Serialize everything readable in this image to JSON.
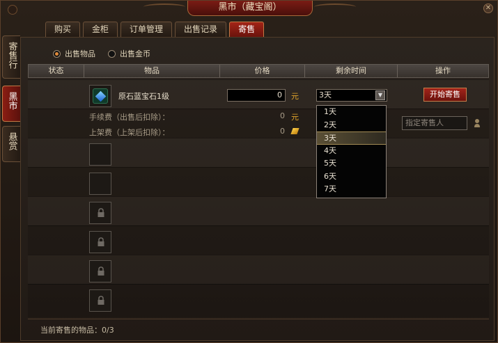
{
  "window": {
    "title": "黑市（藏宝阁）",
    "close_icon": "close-icon"
  },
  "tabs": [
    {
      "label": "购买",
      "active": false
    },
    {
      "label": "金柜",
      "active": false
    },
    {
      "label": "订单管理",
      "active": false
    },
    {
      "label": "出售记录",
      "active": false
    },
    {
      "label": "寄售",
      "active": true
    }
  ],
  "side_tabs": [
    {
      "label": "寄售行",
      "active": false
    },
    {
      "label": "黑市",
      "active": true
    },
    {
      "label": "悬赏",
      "active": false
    }
  ],
  "radios": [
    {
      "label": "出售物品",
      "checked": true
    },
    {
      "label": "出售金币",
      "checked": false
    }
  ],
  "table_headers": [
    "状态",
    "物品",
    "价格",
    "剩余时间",
    "操作"
  ],
  "item": {
    "name": "原石蓝宝石1级",
    "price_value": "0",
    "currency": "元"
  },
  "fee_rows": [
    {
      "label": "手续费（出售后扣除）：",
      "value": "0",
      "unit": "元"
    },
    {
      "label": "上架费（上架后扣除）：",
      "value": "0",
      "unit": "gold-ingot-icon"
    }
  ],
  "duration_select": {
    "selected": "3天",
    "options": [
      "1天",
      "2天",
      "3天",
      "4天",
      "5天",
      "6天",
      "7天"
    ]
  },
  "start_button": "开始寄售",
  "seller_input": {
    "placeholder": "指定寄售人"
  },
  "footer": {
    "text": "当前寄售的物品：0/3"
  },
  "colors": {
    "accent_red": "#8b1d13",
    "gold": "#e0a32a"
  }
}
